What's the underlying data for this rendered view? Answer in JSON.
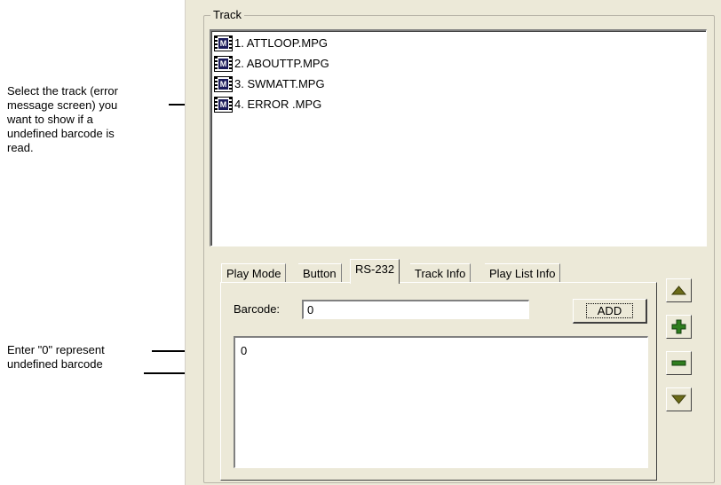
{
  "annotations": {
    "track_note": [
      "Select the track (error",
      "message screen) you",
      "want to show if a",
      "undefined barcode is",
      "read."
    ],
    "barcode_note": [
      "Enter \"0\" represent",
      "undefined barcode"
    ]
  },
  "group": {
    "title": "Track"
  },
  "tracks": [
    {
      "label": "1. ATTLOOP.MPG",
      "icon": "mpg-film-icon"
    },
    {
      "label": "2. ABOUTTP.MPG",
      "icon": "mpg-film-icon"
    },
    {
      "label": "3. SWMATT.MPG",
      "icon": "mpg-film-icon"
    },
    {
      "label": "4. ERROR .MPG",
      "icon": "mpg-film-icon"
    }
  ],
  "tabs": [
    "Play Mode",
    "Button",
    "RS-232",
    "Track Info",
    "Play List Info"
  ],
  "active_tab": "RS-232",
  "rs232": {
    "barcode_label": "Barcode:",
    "barcode_value": "0",
    "add_label": "ADD",
    "barcodes": [
      "0"
    ]
  },
  "side_buttons": [
    {
      "icon": "arrow-up-icon"
    },
    {
      "icon": "plus-icon"
    },
    {
      "icon": "minus-icon"
    },
    {
      "icon": "arrow-down-icon"
    }
  ],
  "colors": {
    "panel": "#ece9d8",
    "icon_olive": "#6b6b18",
    "icon_green": "#2e7d1e"
  }
}
